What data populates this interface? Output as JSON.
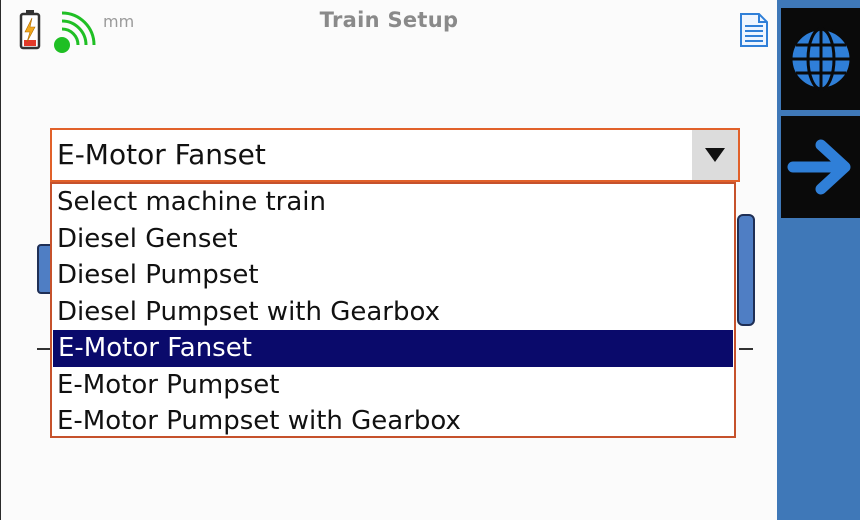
{
  "header": {
    "title": "Train Setup",
    "unit": "mm",
    "icons": {
      "battery": "battery-charging-icon",
      "signal": "wireless-signal-icon",
      "document": "document-icon"
    }
  },
  "select": {
    "value": "E-Motor Fanset",
    "arrow_icon": "dropdown-arrow-icon",
    "options": [
      "Select machine train",
      "Diesel Genset",
      "Diesel Pumpset",
      "Diesel Pumpset with Gearbox",
      "E-Motor Fanset",
      "E-Motor Pumpset",
      "E-Motor Pumpset with Gearbox"
    ],
    "selected_index": 4
  },
  "sidebar": {
    "buttons": [
      {
        "icon": "globe-icon"
      },
      {
        "icon": "arrow-right-icon"
      }
    ]
  },
  "colors": {
    "accent_border": "#e1612a",
    "selection_bg": "#0a0a6b",
    "sidebar_bg": "#3f78b8",
    "icon_blue": "#2f7fd8",
    "signal_green": "#1fbf24"
  }
}
